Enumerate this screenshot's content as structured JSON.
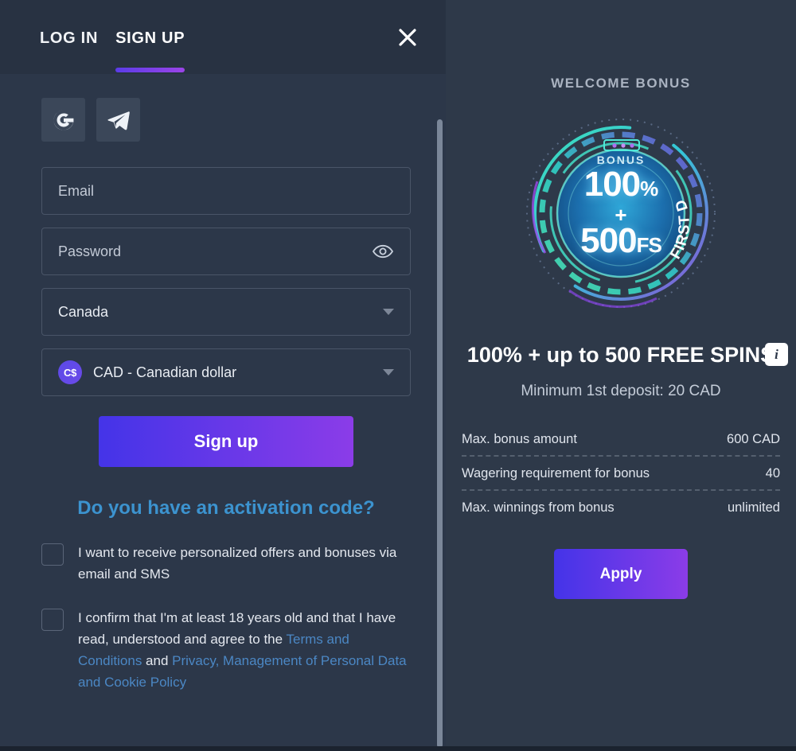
{
  "modal": {
    "tabs": [
      {
        "label": "LOG IN",
        "active": false
      },
      {
        "label": "SIGN UP",
        "active": true
      }
    ],
    "close_icon": "close-icon",
    "accent_color": "#7b3ce8"
  },
  "form": {
    "social": [
      {
        "name": "google-icon",
        "label": "Google"
      },
      {
        "name": "telegram-icon",
        "label": "Telegram"
      }
    ],
    "email": {
      "placeholder": "Email",
      "value": ""
    },
    "password": {
      "placeholder": "Password",
      "value": "",
      "reveal_icon": "eye-icon"
    },
    "country": {
      "value": "Canada"
    },
    "currency": {
      "value": "CAD - Canadian dollar",
      "badge": "C$"
    },
    "submit_label": "Sign up",
    "activation_link": "Do you have an activation code?",
    "checkboxes": [
      {
        "id": "marketing",
        "checked": false,
        "text": "I want to receive personalized offers and bonuses via email and SMS"
      },
      {
        "id": "terms",
        "checked": false,
        "prefix": "I confirm that I'm at least 18 years old and that I have read, understood and agree to the ",
        "link1": "Terms and Conditions",
        "middle": " and ",
        "link2": "Privacy, Management of Personal Data and Cookie Policy"
      }
    ]
  },
  "bonus": {
    "section_title": "WELCOME BONUS",
    "badge": {
      "bonus_label": "BONUS",
      "percent": "100",
      "percent_symbol": "%",
      "plus": "+",
      "spins": "500",
      "spins_unit": "FS",
      "ribbon": "FIRST DEPOSIT"
    },
    "offer_title": "100% + up to 500 FREE SPINS",
    "info_icon": "info-icon",
    "min_deposit": "Minimum 1st deposit: 20 CAD",
    "details": [
      {
        "label": "Max. bonus amount",
        "value": "600 CAD"
      },
      {
        "label": "Wagering requirement for bonus",
        "value": "40"
      },
      {
        "label": "Max. winnings from bonus",
        "value": "unlimited"
      }
    ],
    "apply_label": "Apply"
  }
}
